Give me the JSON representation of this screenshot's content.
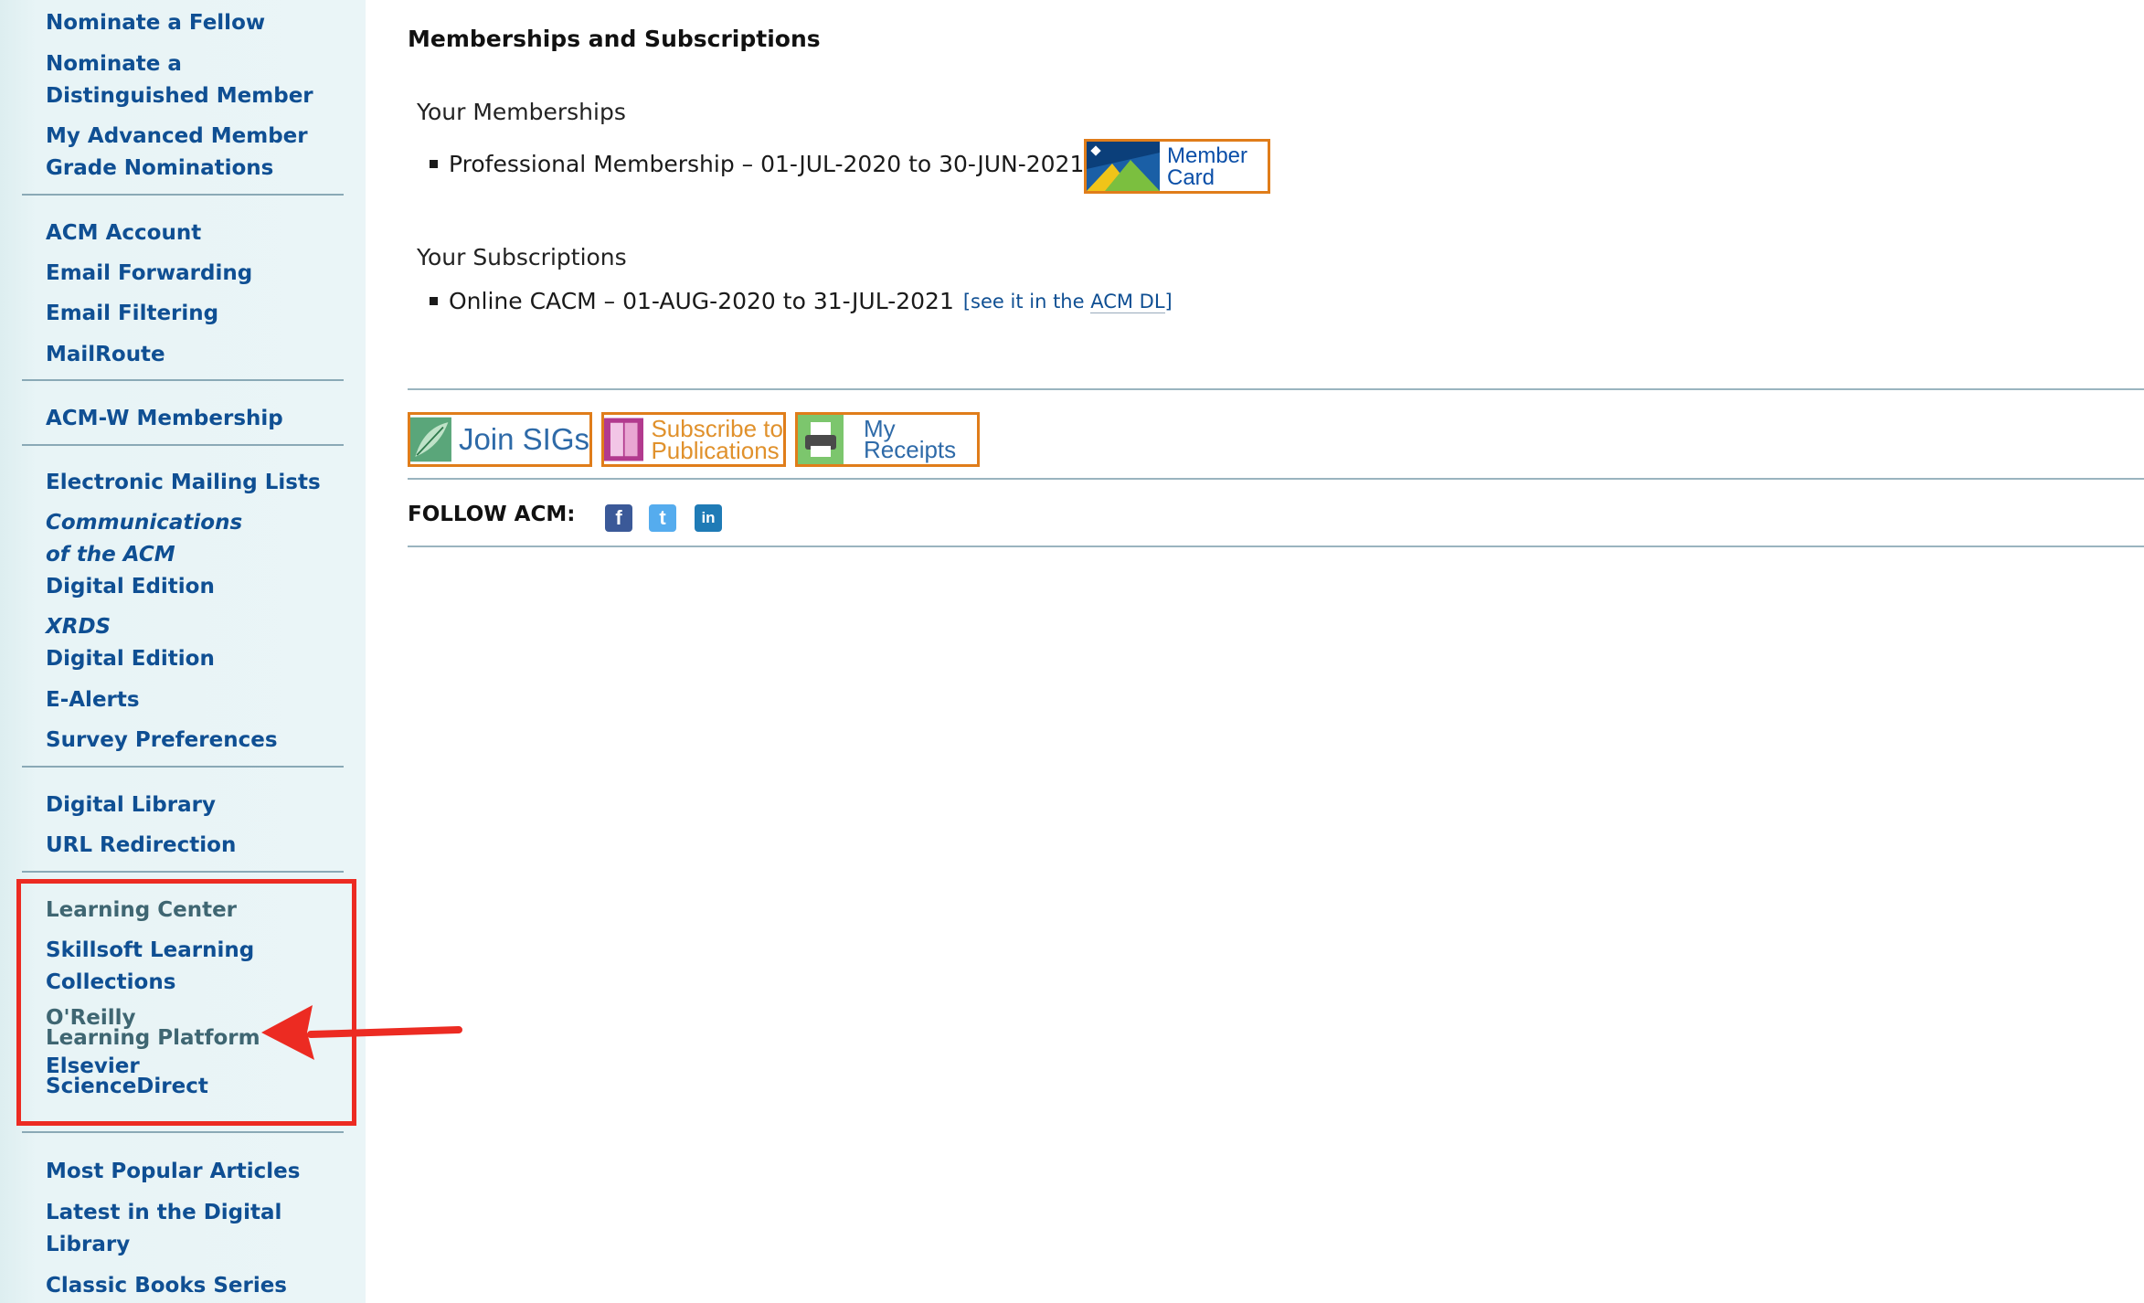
{
  "sidebar": {
    "items": [
      {
        "label": "Nominate a Fellow"
      },
      {
        "label": "Nominate a"
      },
      {
        "label": "Distinguished Member"
      },
      {
        "label": "My Advanced Member"
      },
      {
        "label": "Grade Nominations"
      },
      {
        "label": "ACM Account"
      },
      {
        "label": "Email Forwarding"
      },
      {
        "label": "Email Filtering"
      },
      {
        "label": "MailRoute"
      },
      {
        "label": "ACM-W Membership"
      },
      {
        "label": "Electronic Mailing Lists"
      },
      {
        "label": "Communications"
      },
      {
        "label": "of the ACM"
      },
      {
        "label": "Digital Edition"
      },
      {
        "label": "XRDS"
      },
      {
        "label": "Digital Edition"
      },
      {
        "label": "E-Alerts"
      },
      {
        "label": "Survey Preferences"
      },
      {
        "label": "Digital Library"
      },
      {
        "label": "URL Redirection"
      },
      {
        "label": "Learning Center"
      },
      {
        "label": "Skillsoft Learning"
      },
      {
        "label": "Collections"
      },
      {
        "label": "O'Reilly"
      },
      {
        "label": "Learning Platform"
      },
      {
        "label": "Elsevier"
      },
      {
        "label": "ScienceDirect"
      },
      {
        "label": "Most Popular Articles"
      },
      {
        "label": "Latest in the Digital"
      },
      {
        "label": "Library"
      },
      {
        "label": "Classic Books Series"
      }
    ]
  },
  "main": {
    "title": "Memberships and Subscriptions",
    "memberships_heading": "Your Memberships",
    "membership_item": "Professional Membership – 01-JUL-2020 to 30-JUN-2021",
    "member_card": {
      "line1": "Member",
      "line2": "Card"
    },
    "subscriptions_heading": "Your Subscriptions",
    "subscription_item": "Online CACM – 01-AUG-2020 to 31-JUL-2021",
    "dl_link": {
      "prefix": "[see it in the ",
      "link": "ACM DL",
      "suffix": "]"
    },
    "buttons": {
      "join_sigs": "Join SIGs",
      "subscribe_line1": "Subscribe to",
      "subscribe_line2": "Publications",
      "receipts_line1": "My",
      "receipts_line2": "Receipts"
    },
    "follow_label": "FOLLOW ACM:"
  },
  "social": {
    "facebook": "f",
    "twitter": "t",
    "linkedin": "in"
  },
  "colors": {
    "link": "#0f4f93",
    "sidebar_bg": "#eaf5f7",
    "annotation": "#ec2b22",
    "button_border": "#e07d1a"
  }
}
